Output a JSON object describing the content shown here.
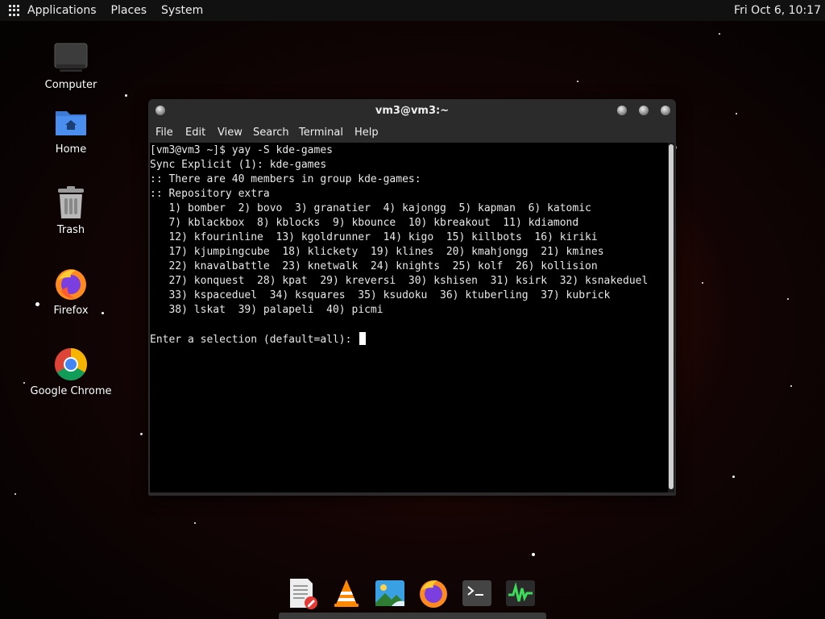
{
  "topbar": {
    "applications": "Applications",
    "places": "Places",
    "system": "System",
    "clock": "Fri Oct  6, 10:17"
  },
  "desktop": {
    "icons": [
      {
        "label": "Computer",
        "icon": "computer-icon"
      },
      {
        "label": "Home",
        "icon": "home-folder-icon"
      },
      {
        "label": "Trash",
        "icon": "trash-icon"
      },
      {
        "label": "Firefox",
        "icon": "firefox-icon"
      },
      {
        "label": "Google Chrome",
        "icon": "chrome-icon"
      }
    ]
  },
  "window": {
    "title": "vm3@vm3:~",
    "menu": [
      "File",
      "Edit",
      "View",
      "Search",
      "Terminal",
      "Help"
    ]
  },
  "terminal": {
    "lines": [
      "[vm3@vm3 ~]$ yay -S kde-games",
      "Sync Explicit (1): kde-games",
      ":: There are 40 members in group kde-games:",
      ":: Repository extra",
      "   1) bomber  2) bovo  3) granatier  4) kajongg  5) kapman  6) katomic",
      "   7) kblackbox  8) kblocks  9) kbounce  10) kbreakout  11) kdiamond",
      "   12) kfourinline  13) kgoldrunner  14) kigo  15) killbots  16) kiriki",
      "   17) kjumpingcube  18) klickety  19) klines  20) kmahjongg  21) kmines",
      "   22) knavalbattle  23) knetwalk  24) knights  25) kolf  26) kollision",
      "   27) konquest  28) kpat  29) kreversi  30) kshisen  31) ksirk  32) ksnakeduel",
      "   33) kspaceduel  34) ksquares  35) ksudoku  36) ktuberling  37) kubrick",
      "   38) lskat  39) palapeli  40) picmi"
    ],
    "prompt": "Enter a selection (default=all): "
  },
  "dock": {
    "items": [
      "text-editor-icon",
      "vlc-icon",
      "image-viewer-icon",
      "firefox-icon",
      "terminal-icon",
      "system-monitor-icon"
    ]
  },
  "colors": {
    "terminal_bg": "#000000",
    "window_chrome": "#2b2b2b",
    "topbar": "#111111"
  }
}
